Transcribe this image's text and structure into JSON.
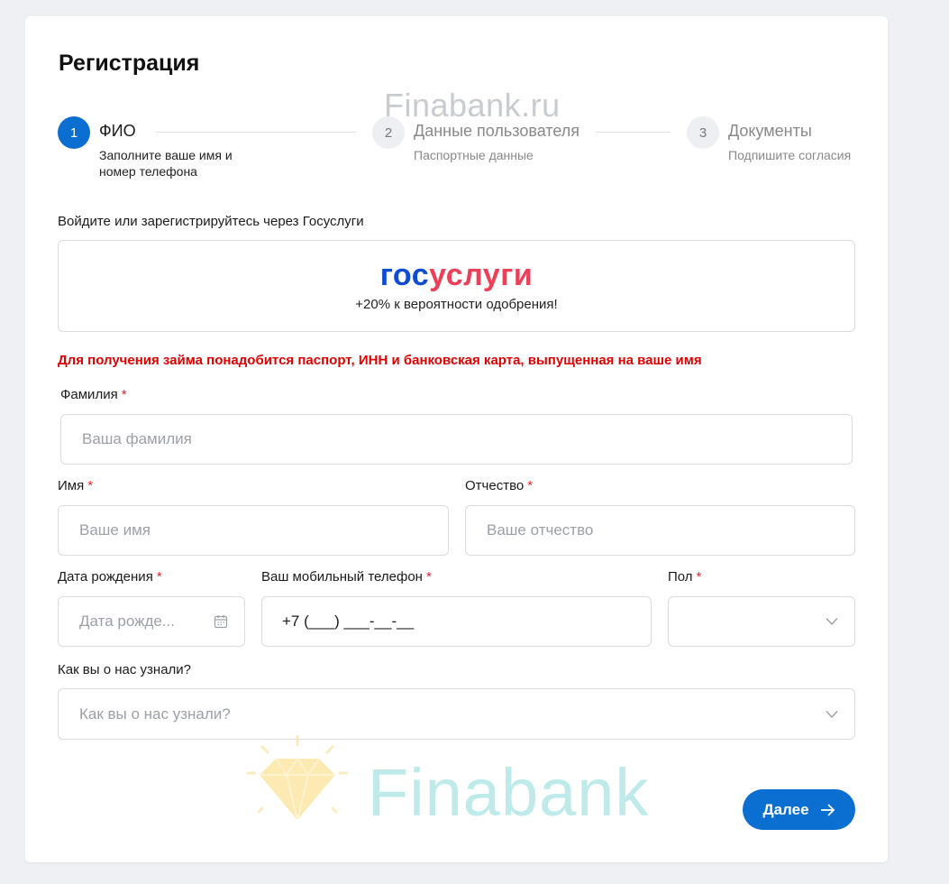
{
  "page": {
    "title": "Регистрация",
    "watermark": "Finabank.ru",
    "watermark_brand": "Finabank"
  },
  "stepper": [
    {
      "number": "1",
      "title": "ФИО",
      "subtitle": "Заполните ваше имя и номер телефона",
      "active": true
    },
    {
      "number": "2",
      "title": "Данные пользователя",
      "subtitle": "Паспортные данные",
      "active": false
    },
    {
      "number": "3",
      "title": "Документы",
      "subtitle": "Подпишите согласия",
      "active": false
    }
  ],
  "gosuslugi": {
    "prompt": "Войдите или зарегистрируйтесь через Госуслуги",
    "logo_part1": "гос",
    "logo_part2": "услуги",
    "bonus": "+20% к вероятности одобрения!"
  },
  "warning": "Для получения займа понадобится паспорт, ИНН и банковская карта, выпущенная на ваше имя",
  "form": {
    "surname": {
      "label": "Фамилия",
      "required": "*",
      "placeholder": "Ваша фамилия"
    },
    "name": {
      "label": "Имя",
      "required": "*",
      "placeholder": "Ваше имя"
    },
    "patronymic": {
      "label": "Отчество",
      "required": "*",
      "placeholder": "Ваше отчество"
    },
    "birthdate": {
      "label": "Дата рождения",
      "required": "*",
      "placeholder": "Дата рожде..."
    },
    "phone": {
      "label": "Ваш мобильный телефон",
      "required": "*",
      "value": "+7 (___) ___-__-__"
    },
    "gender": {
      "label": "Пол",
      "required": "*",
      "value": ""
    },
    "source": {
      "label": "Как вы о нас узнали?",
      "placeholder": "Как вы о нас узнали?"
    }
  },
  "actions": {
    "next_label": "Далее"
  },
  "colors": {
    "accent": "#0b6fd1",
    "required": "#e3262b",
    "warning": "#e00000",
    "gos_blue": "#0d4cd3",
    "gos_red": "#ee3f58"
  },
  "icons": {
    "calendar": "calendar-icon",
    "chevron": "chevron-down-icon",
    "arrow": "arrow-right-icon"
  }
}
